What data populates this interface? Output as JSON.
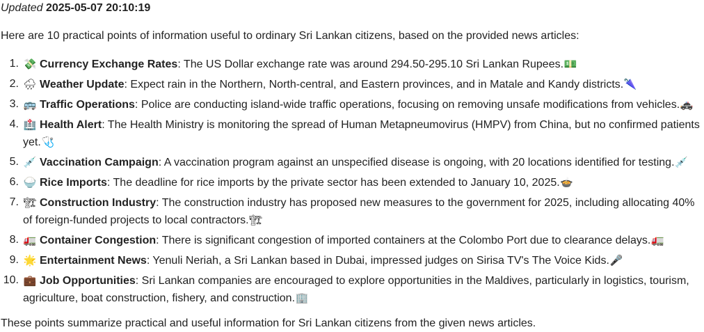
{
  "header": {
    "updated_label": "Updated",
    "updated_timestamp": "2025-05-07 20:10:19"
  },
  "intro": "Here are 10 practical points of information useful to ordinary Sri Lankan citizens, based on the provided news articles:",
  "points": [
    {
      "number": "1.",
      "icon": "💸",
      "title": "Currency Exchange Rates",
      "text": ": The US Dollar exchange rate was around 294.50-295.10 Sri Lankan Rupees.",
      "trail_icon": "💵"
    },
    {
      "number": "2.",
      "icon": "🌧",
      "title": "Weather Update",
      "text": ": Expect rain in the Northern, North-central, and Eastern provinces, and in Matale and Kandy districts.",
      "trail_icon": "🌂"
    },
    {
      "number": "3.",
      "icon": "🚌",
      "title": "Traffic Operations",
      "text": ": Police are conducting island-wide traffic operations, focusing on removing unsafe modifications from vehicles.",
      "trail_icon": "🚓"
    },
    {
      "number": "4.",
      "icon": "🏥",
      "title": "Health Alert",
      "text": ": The Health Ministry is monitoring the spread of Human Metapneumovirus (HMPV) from China, but no confirmed patients yet.",
      "trail_icon": "🩺"
    },
    {
      "number": "5.",
      "icon": "💉",
      "title": "Vaccination Campaign",
      "text": ": A vaccination program against an unspecified disease is ongoing, with 20 locations identified for testing.",
      "trail_icon": "💉"
    },
    {
      "number": "6.",
      "icon": "🍚",
      "title": "Rice Imports",
      "text": ": The deadline for rice imports by the private sector has been extended to January 10, 2025.",
      "trail_icon": "🍲"
    },
    {
      "number": "7.",
      "icon": "🏗",
      "title": "Construction Industry",
      "text": ": The construction industry has proposed new measures to the government for 2025, including allocating 40% of foreign-funded projects to local contractors.",
      "trail_icon": "🏗"
    },
    {
      "number": "8.",
      "icon": "🚛",
      "title": "Container Congestion",
      "text": ": There is significant congestion of imported containers at the Colombo Port due to clearance delays.",
      "trail_icon": "🚛"
    },
    {
      "number": "9.",
      "icon": "🌟",
      "title": "Entertainment News",
      "text": ": Yenuli Neriah, a Sri Lankan based in Dubai, impressed judges on Sirisa TV's The Voice Kids.",
      "trail_icon": "🎤"
    },
    {
      "number": "10.",
      "icon": "💼",
      "title": "Job Opportunities",
      "text": ": Sri Lankan companies are encouraged to explore opportunities in the Maldives, particularly in logistics, tourism, agriculture, boat construction, fishery, and construction.",
      "trail_icon": "🏢"
    }
  ],
  "outro": "These points summarize practical and useful information for Sri Lankan citizens from the given news articles."
}
